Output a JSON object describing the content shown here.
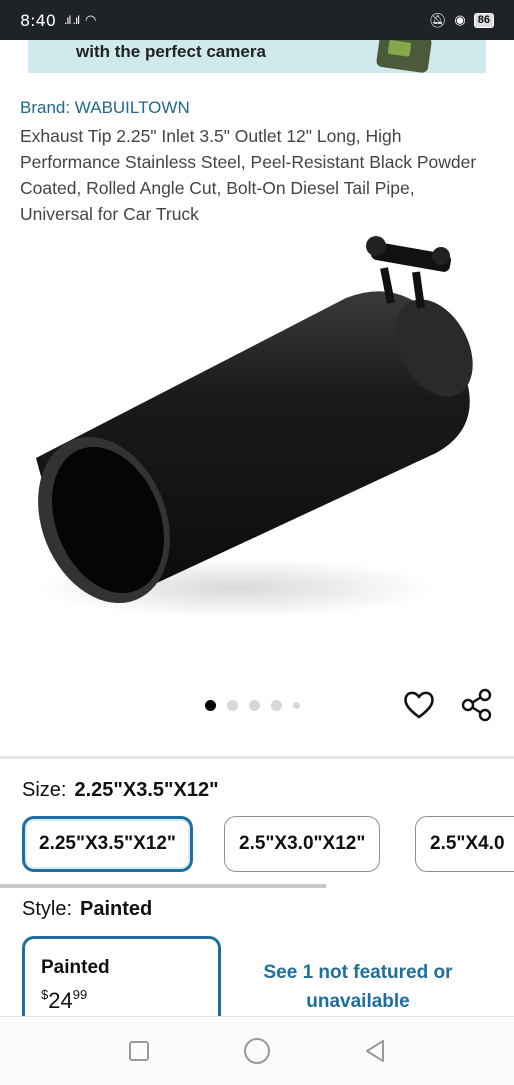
{
  "status_bar": {
    "time": "8:40",
    "signal": ".ıl .ıl",
    "battery": "86"
  },
  "banner": {
    "text": "with the perfect camera"
  },
  "product": {
    "brand": "Brand: WABUILTOWN",
    "title": "Exhaust Tip 2.25\" Inlet 3.5\" Outlet 12\" Long, High Performance Stainless Steel, Peel-Resistant Black Powder Coated, Rolled Angle Cut, Bolt-On Diesel Tail Pipe, Universal for Car Truck",
    "image_count": 5,
    "active_image": 1
  },
  "size": {
    "label": "Size:",
    "selected": "2.25\"X3.5\"X12\"",
    "options": [
      "2.25\"X3.5\"X12\"",
      "2.5\"X3.0\"X12\"",
      "2.5\"X4.0"
    ]
  },
  "style": {
    "label": "Style:",
    "selected": "Painted",
    "card_name": "Painted",
    "price_currency": "$",
    "price_whole": "24",
    "price_fraction": "99",
    "not_featured": "See 1 not featured or unavailable"
  }
}
